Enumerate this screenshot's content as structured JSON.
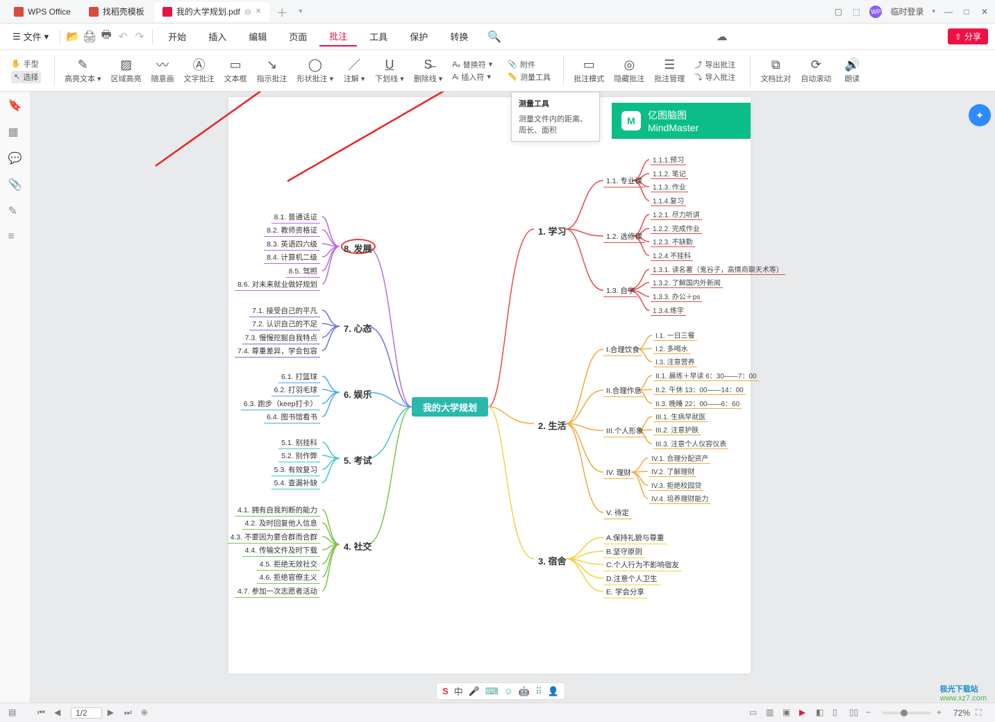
{
  "titlebar": {
    "tabs": [
      {
        "icon": "#d94b3a",
        "label": "WPS Office"
      },
      {
        "icon": "#d94b3a",
        "label": "找稻壳模板"
      },
      {
        "icon": "#e14",
        "label": "我的大学规划.pdf",
        "active": true
      }
    ],
    "login": "临时登录"
  },
  "menubar": {
    "file": "文件",
    "tabs": [
      "开始",
      "插入",
      "编辑",
      "页面",
      "批注",
      "工具",
      "保护",
      "转换"
    ],
    "active": "批注",
    "share": "分享"
  },
  "ribbon": {
    "hand": "手型",
    "select": "选择",
    "highlight": "高亮文本",
    "areahl": "区域高亮",
    "scribble": "随意画",
    "textnote": "文字批注",
    "textbox": "文本框",
    "pointnote": "指示批注",
    "shapenote": "形状批注",
    "annotate": "注解",
    "underline": "下划线",
    "strikeout": "删除线",
    "replace": "替换符",
    "insert": "插入符",
    "attach": "附件",
    "measure": "测量工具",
    "mode": "批注模式",
    "hide": "隐藏批注",
    "manage": "批注管理",
    "export": "导出批注",
    "import": "导入批注",
    "compare": "文档比对",
    "scroll": "自动滚动",
    "read": "朗读"
  },
  "tooltip": {
    "title": "测量工具",
    "body": "测量文件内的距离、周长、面积"
  },
  "brand": {
    "cn": "亿图脑图",
    "en": "MindMaster"
  },
  "root": "我的大学规划",
  "branches": {
    "b1": "1. 学习",
    "b2": "2. 生活",
    "b3": "3. 宿舍",
    "b4": "4. 社交",
    "b5": "5. 考试",
    "b6": "6. 娱乐",
    "b7": "7. 心态",
    "b8": "8. 发展"
  },
  "leaves": {
    "l11": "1.1. 专业课",
    "l12": "1.2. 选修课",
    "l13": "1.3. 自学",
    "l111": "1.1.1.预习",
    "l112": "1.1.2. 笔记",
    "l113": "1.1.3. 作业",
    "l114": "1.1.4.复习",
    "l121": "1.2.1. 尽力听讲",
    "l122": "1.2.2. 完成作业",
    "l123": "1.2.3. 不缺勤",
    "l124": "1.2.4.不挂科",
    "l131": "1.3.1. 读名著（鬼谷子，高情商聊天术等）",
    "l132": "1.3.2. 了解国内外新闻",
    "l133": "1.3.3. 办公＋ps",
    "l134": "1.3.4.练字",
    "l21": "I.合理饮食",
    "l22": "II.合理作息",
    "l23": "III.个人形象",
    "l24": "IV. 理财",
    "l25": "V. 待定",
    "l211": "I.1. 一日三餐",
    "l212": "I.2. 多喝水",
    "l213": "I.3. 注意营养",
    "l221": "II.1. 晨练＋早读 6：30——7：00",
    "l222": "II.2. 午休 13：00——14：00",
    "l223": "II.3. 晚睡 22：00——6：60",
    "l231": "III.1. 生病早就医",
    "l232": "III.2. 注意护肤",
    "l233": "III.3. 注意个人仪容仪表",
    "l241": "IV.1. 合理分配资产",
    "l242": "IV.2. 了解理财",
    "l243": "IV.3. 拒绝校园贷",
    "l244": "IV.4. 培养理财能力",
    "l31": "A.保持礼貌与尊重",
    "l32": "B.坚守原则",
    "l33": "C.个人行为不影响宿友",
    "l34": "D.注意个人卫生",
    "l35": "E. 学会分享",
    "l41": "4.1. 拥有自我判断的能力",
    "l42": "4.2. 及时回复他人信息",
    "l43": "4.3. 不要因为要合群而合群",
    "l44": "4.4. 传输文件及时下载",
    "l45": "4.5. 拒绝无效社交",
    "l46": "4.6. 拒绝官僚主义",
    "l47": "4.7. 参加一次志愿者活动",
    "l51": "5.1. 别挂科",
    "l52": "5.2. 别作弊",
    "l53": "5.3. 有效复习",
    "l54": "5.4. 查漏补缺",
    "l61": "6.1. 打篮球",
    "l62": "6.2. 打羽毛球",
    "l63": "6.3. 跑步（keep打卡）",
    "l64": "6.4. 图书馆看书",
    "l71": "7.1. 接受自己的平凡",
    "l72": "7.2. 认识自己的不足",
    "l73": "7.3. 慢慢挖掘自我特点",
    "l74": "7.4. 尊重差异，学会包容",
    "l81": "8.1. 普通话证",
    "l82": "8.2. 教师资格证",
    "l83": "8.3. 英语四六级",
    "l84": "8.4. 计算机二级",
    "l85": "8.5. 驾照",
    "l86": "8.6. 对未来就业做好规划"
  },
  "status": {
    "page": "1/2",
    "zoom": "72%",
    "ime": "中"
  },
  "watermark": {
    "name": "极光下载站",
    "url": "www.xz7.com"
  }
}
